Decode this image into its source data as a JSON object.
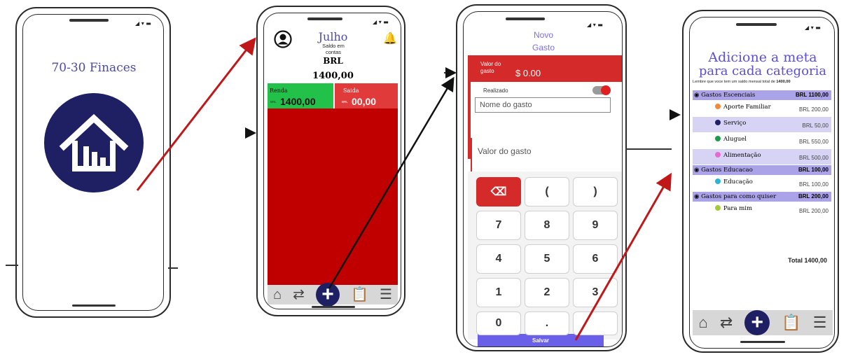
{
  "phone1": {
    "app_title": "70-30 Finaces",
    "logo_icon": "house-chart-icon"
  },
  "phone2": {
    "month": "Julho",
    "balance_label": "Saldo em contas",
    "currency": "BRL",
    "balance_value": "1400,00",
    "income_label": "Renda",
    "income_value": "1400,00",
    "income_prefix": "BRL",
    "expense_label": "Saida",
    "expense_value": "00,00",
    "expense_prefix": "BRL"
  },
  "phone3": {
    "title_line1": "Novo",
    "title_line2": "Gasto",
    "amount_label": "Valor do gasto",
    "amount_value": "$ 0.00",
    "done_label": "Realizado",
    "name_placeholder": "Nome do gasto",
    "value_placeholder": "Valor do gasto",
    "keys": [
      "⌫",
      "(",
      ")",
      "7",
      "8",
      "9",
      "4",
      "5",
      "6",
      "1",
      "2",
      "3",
      "0",
      ".",
      ""
    ],
    "save_label": "Salvar"
  },
  "phone4": {
    "title_line1": "Adicione a meta",
    "title_line2": "para cada categoria",
    "hint_text": "Lembre que voce tem um saldo mensal total de",
    "hint_value": "1400,00",
    "rows": [
      {
        "type": "group",
        "label": "Gastos Escenciais",
        "amount": "BRL 1100,00"
      },
      {
        "type": "item",
        "label": "Aporte Familiar",
        "amount": "BRL 200,00",
        "color": "#f08a3c",
        "bg": "#ffffff"
      },
      {
        "type": "item",
        "label": "Serviço",
        "amount": "BRL 50,00",
        "color": "#1f2064",
        "bg": "#d7d3f5"
      },
      {
        "type": "item",
        "label": "Aluguel",
        "amount": "BRL 550,00",
        "color": "#1a9c4a",
        "bg": "#ffffff"
      },
      {
        "type": "item",
        "label": "Alimentação",
        "amount": "BRL 500,00",
        "color": "#e86ad1",
        "bg": "#d7d3f5"
      },
      {
        "type": "group",
        "label": "Gastos Educacao",
        "amount": "BRL 100,00"
      },
      {
        "type": "item",
        "label": "Educação",
        "amount": "BRL 100,00",
        "color": "#27b5d9",
        "bg": "#ffffff"
      },
      {
        "type": "group",
        "label": "Gastos para como quiser",
        "amount": "BRL 200,00"
      },
      {
        "type": "item",
        "label": "Para mim",
        "amount": "BRL 200,00",
        "color": "#a4c93a",
        "bg": "#ffffff"
      }
    ],
    "total_label": "Total 1400,00"
  },
  "colors": {
    "brand_navy": "#1f2064",
    "expense_red": "#c00000",
    "income_green": "#22c24a",
    "accent_purple": "#7c6ff0",
    "arrow_red": "#c01818"
  }
}
